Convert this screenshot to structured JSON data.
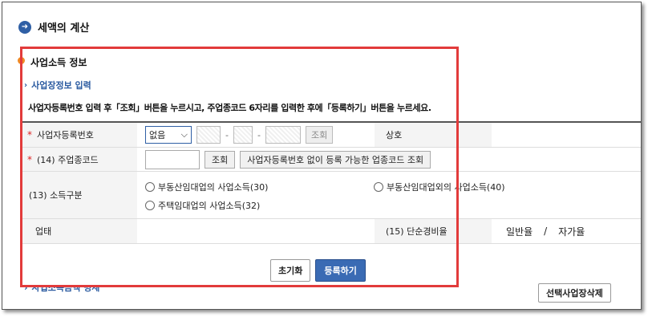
{
  "section_title": "세액의 계산",
  "info_title": "사업소득 정보",
  "workplace_link": "사업장정보 입력",
  "instruction": "사업자등록번호 입력 후「조회」버튼을 누르시고, 주업종코드 6자리를 입력한 후에「등록하기」버튼을 누르세요.",
  "form": {
    "bizno_label": "사업자등록번호",
    "bizno_select": "없음",
    "bizno_dash": "-",
    "lookup": "조회",
    "company_label": "상호",
    "code_label": "(14) 주업종코드",
    "code_lookup": "조회",
    "code_lookup_no_bizno": "사업자등록번호 없이 등록 가능한 업종코드 조회",
    "income_type_label": "(13) 소득구분",
    "income_options": [
      "부동산임대업의 사업소득(30)",
      "주택임대업의 사업소득(32)",
      "부동산임대업외의 사업소득(40)"
    ],
    "business_label": "업태",
    "expense_label": "(15) 단순경비율",
    "rate_general": "일반율",
    "rate_sep": "/",
    "rate_self": "자가율"
  },
  "buttons": {
    "reset": "초기화",
    "register": "등록하기",
    "delete_workplace": "선택사업장삭제"
  },
  "partial_link": "사업소득금액 명세",
  "colors": {
    "accent": "#2f5fa5",
    "highlight_border": "#e23b3b",
    "dot": "#f08a24"
  }
}
